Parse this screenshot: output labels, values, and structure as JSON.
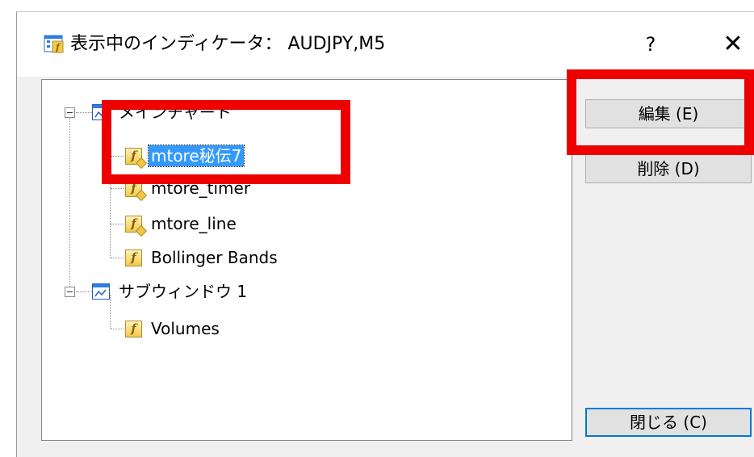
{
  "dialog": {
    "title": "表示中のインディケータ： AUDJPY,M5",
    "help_label": "?",
    "close_label": "✕"
  },
  "tree": {
    "groups": [
      {
        "label": "メインチャート",
        "items": [
          {
            "label": "mtore秘伝7",
            "icon": "custom-indicator-icon",
            "selected": true
          },
          {
            "label": "mtore_timer",
            "icon": "custom-indicator-icon"
          },
          {
            "label": "mtore_line",
            "icon": "custom-indicator-icon"
          },
          {
            "label": "Bollinger Bands",
            "icon": "indicator-icon"
          }
        ]
      },
      {
        "label": "サブウィンドウ 1",
        "items": [
          {
            "label": "Volumes",
            "icon": "indicator-icon"
          }
        ]
      }
    ]
  },
  "buttons": {
    "edit_label": "編集 (E)",
    "delete_label": "削除 (D)",
    "close_label": "閉じる (C)"
  },
  "colors": {
    "highlight_red": "#ee0000",
    "selection_blue": "#3399ff",
    "dialog_bg": "#f0f0f0"
  }
}
